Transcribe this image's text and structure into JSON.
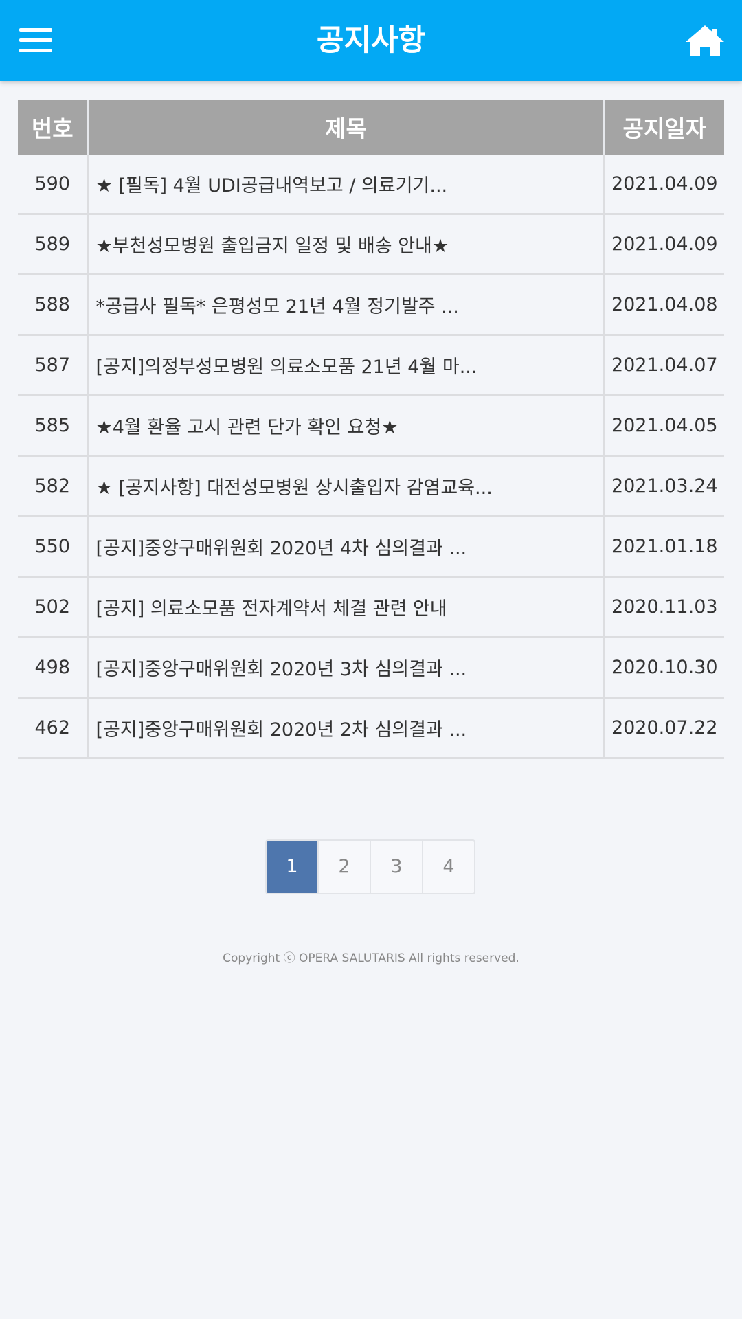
{
  "header": {
    "title": "공지사항",
    "menu_icon": "menu-icon",
    "home_icon": "home-icon"
  },
  "table": {
    "columns": [
      "번호",
      "제목",
      "공지일자"
    ],
    "rows": [
      {
        "num": "590",
        "title": "★ [필독] 4월 UDI공급내역보고 / 의료기기...",
        "date": "2021.04.09"
      },
      {
        "num": "589",
        "title": "★부천성모병원 출입금지 일정 및 배송 안내★",
        "date": "2021.04.09"
      },
      {
        "num": "588",
        "title": "*공급사 필독* 은평성모 21년 4월 정기발주 ...",
        "date": "2021.04.08"
      },
      {
        "num": "587",
        "title": "[공지]의정부성모병원 의료소모품 21년 4월 마...",
        "date": "2021.04.07"
      },
      {
        "num": "585",
        "title": "★4월 환율 고시 관련 단가 확인 요청★",
        "date": "2021.04.05"
      },
      {
        "num": "582",
        "title": "★ [공지사항] 대전성모병원 상시출입자 감염교육...",
        "date": "2021.03.24"
      },
      {
        "num": "550",
        "title": "[공지]중앙구매위원회 2020년 4차 심의결과 ...",
        "date": "2021.01.18"
      },
      {
        "num": "502",
        "title": "[공지] 의료소모품 전자계약서 체결 관련 안내",
        "date": "2020.11.03"
      },
      {
        "num": "498",
        "title": "[공지]중앙구매위원회 2020년 3차 심의결과 ...",
        "date": "2020.10.30"
      },
      {
        "num": "462",
        "title": "[공지]중앙구매위원회 2020년 2차 심의결과 ...",
        "date": "2020.07.22"
      }
    ]
  },
  "pagination": {
    "pages": [
      "1",
      "2",
      "3",
      "4"
    ],
    "current": "1"
  },
  "footer": {
    "copyright": "Copyright ⓒ OPERA SALUTARIS All rights reserved."
  },
  "colors": {
    "header_bg": "#03a9f4",
    "table_header_bg": "#a4a4a4",
    "active_page_bg": "#4e76ad"
  }
}
